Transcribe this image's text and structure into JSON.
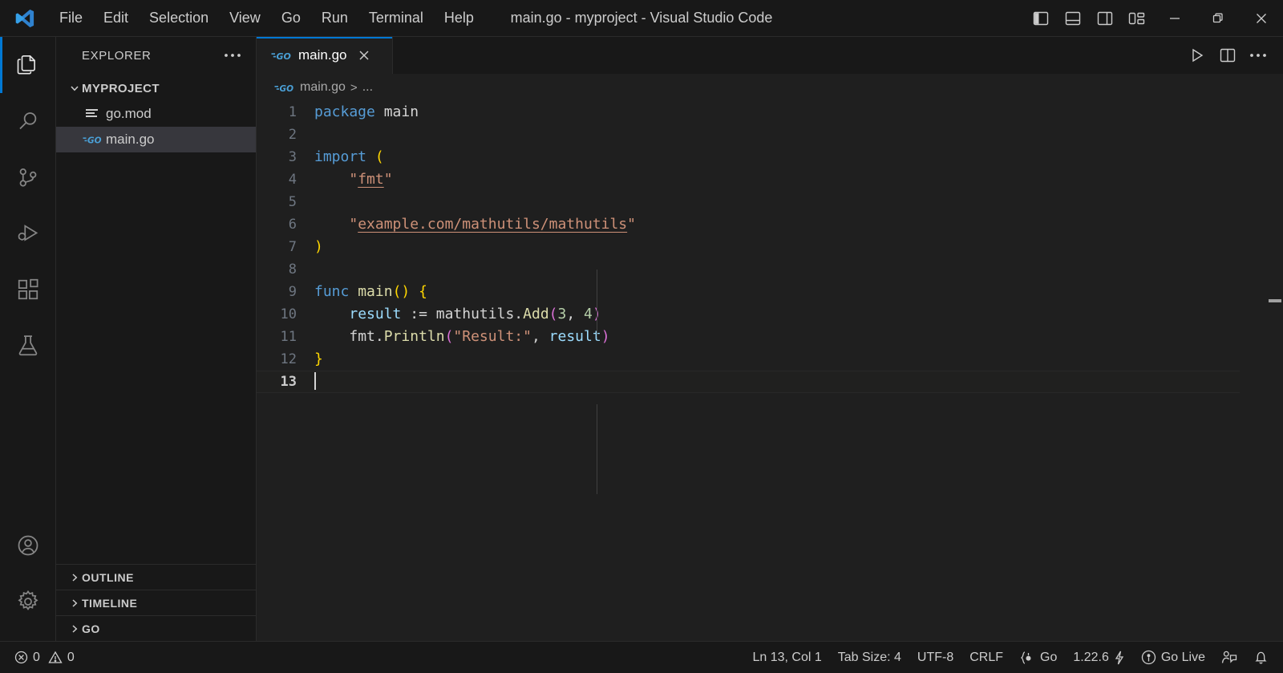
{
  "window": {
    "title": "main.go - myproject - Visual Studio Code",
    "logo_icon": "vscode-logo-icon"
  },
  "menubar": {
    "items": [
      {
        "label": "File"
      },
      {
        "label": "Edit"
      },
      {
        "label": "Selection"
      },
      {
        "label": "View"
      },
      {
        "label": "Go"
      },
      {
        "label": "Run"
      },
      {
        "label": "Terminal"
      },
      {
        "label": "Help"
      }
    ]
  },
  "titlebar_controls": {
    "layout": [
      {
        "name": "toggle-primary-sidebar-icon"
      },
      {
        "name": "toggle-panel-icon"
      },
      {
        "name": "toggle-secondary-sidebar-icon"
      },
      {
        "name": "customize-layout-icon"
      }
    ],
    "window": [
      {
        "name": "minimize-icon"
      },
      {
        "name": "restore-icon"
      },
      {
        "name": "close-icon"
      }
    ]
  },
  "activitybar": {
    "items": [
      {
        "name": "explorer",
        "icon": "files-icon",
        "active": true
      },
      {
        "name": "search",
        "icon": "search-icon",
        "active": false
      },
      {
        "name": "source-control",
        "icon": "source-control-icon",
        "active": false
      },
      {
        "name": "run-and-debug",
        "icon": "run-debug-icon",
        "active": false
      },
      {
        "name": "extensions",
        "icon": "extensions-icon",
        "active": false
      },
      {
        "name": "testing",
        "icon": "beaker-icon",
        "active": false
      }
    ],
    "bottom": [
      {
        "name": "accounts",
        "icon": "account-icon"
      },
      {
        "name": "settings",
        "icon": "gear-icon"
      }
    ]
  },
  "sidebar": {
    "title": "EXPLORER",
    "more_actions_icon": "ellipsis-icon",
    "root": {
      "label": "MYPROJECT",
      "expanded": true
    },
    "files": [
      {
        "label": "go.mod",
        "icon": "go-mod-icon",
        "selected": false
      },
      {
        "label": "main.go",
        "icon": "go-file-icon",
        "selected": true
      }
    ],
    "panels": [
      {
        "label": "OUTLINE",
        "expanded": false
      },
      {
        "label": "TIMELINE",
        "expanded": false
      },
      {
        "label": "GO",
        "expanded": false
      }
    ]
  },
  "editor": {
    "tabs": [
      {
        "label": "main.go",
        "icon": "go-file-icon",
        "active": true,
        "close_icon": "close-icon"
      }
    ],
    "actions": [
      {
        "name": "run-code-button",
        "icon": "play-icon"
      },
      {
        "name": "split-editor-right-button",
        "icon": "split-editor-icon"
      },
      {
        "name": "more-actions-button",
        "icon": "ellipsis-icon"
      }
    ],
    "breadcrumb": {
      "icon": "go-file-icon",
      "items": [
        "main.go",
        "..."
      ],
      "separator": ">"
    },
    "lines": [
      {
        "n": "1",
        "tokens": [
          {
            "t": "package",
            "c": "kw"
          },
          {
            "t": " ",
            "c": "pl"
          },
          {
            "t": "main",
            "c": "pl"
          }
        ]
      },
      {
        "n": "2",
        "tokens": []
      },
      {
        "n": "3",
        "tokens": [
          {
            "t": "import",
            "c": "kw"
          },
          {
            "t": " ",
            "c": "pl"
          },
          {
            "t": "(",
            "c": "br1"
          }
        ]
      },
      {
        "n": "4",
        "tokens": [
          {
            "t": "    ",
            "c": "pl"
          },
          {
            "t": "\"",
            "c": "str"
          },
          {
            "t": "fmt",
            "c": "str link"
          },
          {
            "t": "\"",
            "c": "str"
          }
        ]
      },
      {
        "n": "5",
        "tokens": []
      },
      {
        "n": "6",
        "tokens": [
          {
            "t": "    ",
            "c": "pl"
          },
          {
            "t": "\"",
            "c": "str"
          },
          {
            "t": "example.com/mathutils/mathutils",
            "c": "str link"
          },
          {
            "t": "\"",
            "c": "str"
          }
        ]
      },
      {
        "n": "7",
        "tokens": [
          {
            "t": ")",
            "c": "br1"
          }
        ]
      },
      {
        "n": "8",
        "tokens": []
      },
      {
        "n": "9",
        "tokens": [
          {
            "t": "func",
            "c": "kw"
          },
          {
            "t": " ",
            "c": "pl"
          },
          {
            "t": "main",
            "c": "fn"
          },
          {
            "t": "(",
            "c": "br1"
          },
          {
            "t": ")",
            "c": "br1"
          },
          {
            "t": " ",
            "c": "pl"
          },
          {
            "t": "{",
            "c": "br1"
          }
        ]
      },
      {
        "n": "10",
        "tokens": [
          {
            "t": "    ",
            "c": "pl"
          },
          {
            "t": "result",
            "c": "var"
          },
          {
            "t": " := ",
            "c": "pl"
          },
          {
            "t": "mathutils",
            "c": "pl"
          },
          {
            "t": ".",
            "c": "pl"
          },
          {
            "t": "Add",
            "c": "fn"
          },
          {
            "t": "(",
            "c": "br2"
          },
          {
            "t": "3",
            "c": "num"
          },
          {
            "t": ", ",
            "c": "pl"
          },
          {
            "t": "4",
            "c": "num"
          },
          {
            "t": ")",
            "c": "br2"
          }
        ]
      },
      {
        "n": "11",
        "tokens": [
          {
            "t": "    ",
            "c": "pl"
          },
          {
            "t": "fmt",
            "c": "pl"
          },
          {
            "t": ".",
            "c": "pl"
          },
          {
            "t": "Println",
            "c": "fn"
          },
          {
            "t": "(",
            "c": "br2"
          },
          {
            "t": "\"Result:\"",
            "c": "str"
          },
          {
            "t": ", ",
            "c": "pl"
          },
          {
            "t": "result",
            "c": "var"
          },
          {
            "t": ")",
            "c": "br2"
          }
        ]
      },
      {
        "n": "12",
        "tokens": [
          {
            "t": "}",
            "c": "br1"
          }
        ]
      },
      {
        "n": "13",
        "tokens": [],
        "current": true,
        "cursor": true
      }
    ]
  },
  "statusbar": {
    "left": [
      {
        "name": "problems-errors",
        "icon": "error-circle-icon",
        "label": "0"
      },
      {
        "name": "problems-warnings",
        "icon": "warning-triangle-icon",
        "label": "0"
      }
    ],
    "right": [
      {
        "name": "editor-position",
        "label": "Ln 13, Col 1"
      },
      {
        "name": "editor-indentation",
        "label": "Tab Size: 4"
      },
      {
        "name": "editor-encoding",
        "label": "UTF-8"
      },
      {
        "name": "editor-eol",
        "label": "CRLF"
      },
      {
        "name": "editor-language",
        "icon": "go-brackets-icon",
        "label": "Go"
      },
      {
        "name": "go-version",
        "label": "1.22.6",
        "icon": "zap-icon"
      },
      {
        "name": "go-live",
        "icon": "broadcast-icon",
        "label": "Go Live"
      },
      {
        "name": "feedback",
        "icon": "feedback-icon",
        "label": ""
      },
      {
        "name": "notifications",
        "icon": "bell-icon",
        "label": ""
      }
    ]
  },
  "colors": {
    "accent": "#0078d4",
    "titlebar_bg": "#181818",
    "editor_bg": "#1f1f1f",
    "sidebar_selected": "#37373d",
    "go_blue": "#4a9fd5"
  }
}
